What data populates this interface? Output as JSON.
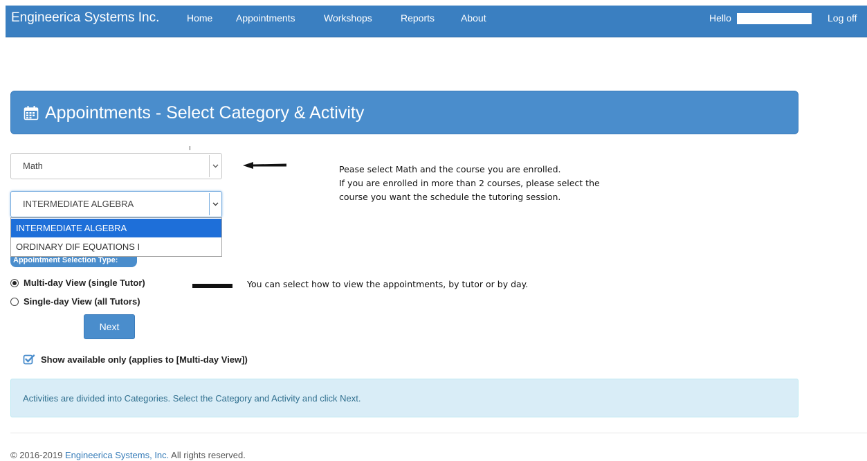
{
  "navbar": {
    "brand": "Engineerica Systems Inc.",
    "links": [
      "Home",
      "Appointments",
      "Workshops",
      "Reports",
      "About"
    ],
    "hello": "Hello",
    "logoff": "Log off",
    "color": "#3a7fc1"
  },
  "panel": {
    "title": "Appointments - Select Category & Activity",
    "icon": "calendar-icon"
  },
  "category_select": {
    "value": "Math"
  },
  "activity_select": {
    "value": "INTERMEDIATE ALGEBRA",
    "options": [
      "INTERMEDIATE ALGEBRA",
      "ORDINARY DIF EQUATIONS I"
    ],
    "selected_index": 0
  },
  "selection_type": {
    "label": "Appointment Selection Type:",
    "options": [
      {
        "label": "Multi-day View (single Tutor)",
        "checked": true
      },
      {
        "label": "Single-day View (all Tutors)",
        "checked": false
      }
    ]
  },
  "next_button": "Next",
  "show_available": {
    "label": "Show available only (applies to [Multi-day View])",
    "checked": true
  },
  "info": "Activities are divided into Categories. Select the Category and Activity and click Next.",
  "footer": {
    "prefix": "© 2016-2019 ",
    "link": "Engineerica Systems, Inc.",
    "suffix": " All rights reserved."
  },
  "annotations": {
    "note_1": [
      "Pease select Math and the course you are enrolled.",
      "If you are enrolled in more than 2 courses, please select the",
      "course you want the schedule the tutoring session."
    ],
    "note_2": "You can select how to view the appointments, by tutor or by day."
  },
  "colors": {
    "accent": "#4a8dcc",
    "selected": "#1e6fd9",
    "info_bg": "#d9edf7",
    "info_text": "#31708f"
  }
}
